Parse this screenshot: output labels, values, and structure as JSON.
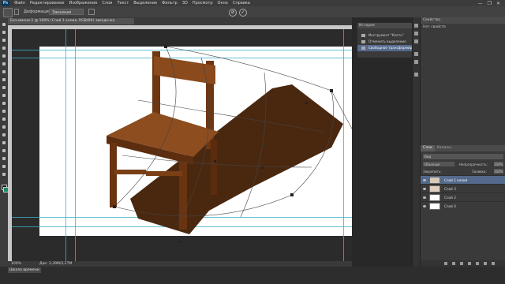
{
  "menubar": {
    "logo": "Ps",
    "items": [
      "Файл",
      "Редактирование",
      "Изображение",
      "Слои",
      "Текст",
      "Выделение",
      "Фильтр",
      "3D",
      "Просмотр",
      "Окно",
      "Справка"
    ],
    "window_controls": [
      "—",
      "❐",
      "✕"
    ]
  },
  "options": {
    "mode_label": "Деформация:",
    "mode_value": "Заказная"
  },
  "document": {
    "tab_title": "Без-имени-1 @ 100% (Слой 1 копия, RGB/8#) звездочка"
  },
  "status": {
    "zoom": "100%",
    "doc_info": "Док: 1,39M/3,27M"
  },
  "bottom": {
    "tab_label": "Шкала времени"
  },
  "history": {
    "title": "История",
    "items": [
      {
        "label": "Инструмент \"Кисть\"",
        "active": false
      },
      {
        "label": "Отменить выделение",
        "active": false
      },
      {
        "label": "Свободное трансформир...",
        "active": true
      }
    ]
  },
  "properties": {
    "title": "Свойства",
    "subtitle": "Нет свойств"
  },
  "layers": {
    "tabs": [
      "Слои",
      "Каналы"
    ],
    "filter_label": "Вид",
    "blend_mode": "Обычные",
    "opacity_label": "Непрозрачность:",
    "opacity_value": "100%",
    "lock_label": "Закрепить:",
    "fill_label": "Заливка:",
    "fill_value": "100%",
    "items": [
      {
        "name": "Слой 1 копия",
        "selected": true
      },
      {
        "name": "Слой 3",
        "selected": false
      },
      {
        "name": "Слой 2",
        "selected": false
      },
      {
        "name": "Слой 0",
        "selected": false
      }
    ]
  },
  "colors": {
    "guide": "#3ab0c8",
    "selection": "#546a8c",
    "chair_wood": "#7a3f15",
    "shadow": "#4a2810"
  }
}
